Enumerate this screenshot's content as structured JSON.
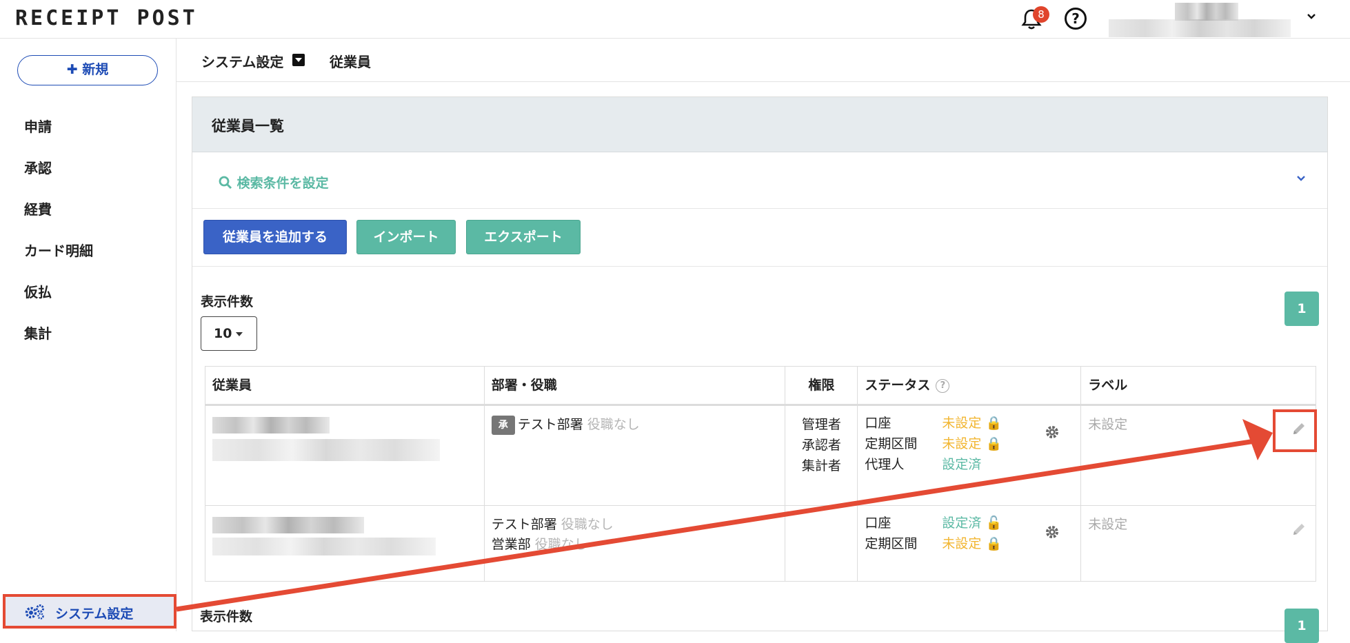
{
  "app": {
    "logo": "RECEIPT POST",
    "notification_count": "8"
  },
  "sidebar": {
    "new_button": "新規",
    "items": [
      {
        "label": "申請"
      },
      {
        "label": "承認"
      },
      {
        "label": "経費"
      },
      {
        "label": "カード明細"
      },
      {
        "label": "仮払"
      },
      {
        "label": "集計"
      }
    ],
    "system_settings": "システム設定"
  },
  "breadcrumb": {
    "section": "システム設定",
    "page": "従業員"
  },
  "card": {
    "title": "従業員一覧",
    "search_link": "検索条件を設定",
    "buttons": {
      "add": "従業員を追加する",
      "import": "インポート",
      "export": "エクスポート"
    },
    "count_label": "表示件数",
    "count_value": "10",
    "page": "1"
  },
  "table": {
    "headers": {
      "employee": "従業員",
      "dept": "部署・役職",
      "role": "権限",
      "status": "ステータス",
      "label": "ラベル"
    },
    "rows": [
      {
        "badge": "承",
        "dept1": "テスト部署",
        "title1": "役職なし",
        "roles": [
          "管理者",
          "承認者",
          "集計者"
        ],
        "status": [
          {
            "k": "口座",
            "v": "未設定",
            "state": "locked"
          },
          {
            "k": "定期区間",
            "v": "未設定",
            "state": "locked"
          },
          {
            "k": "代理人",
            "v": "設定済",
            "state": "none"
          }
        ],
        "label": "未設定"
      },
      {
        "dept1": "テスト部署",
        "title1": "役職なし",
        "dept2": "営業部",
        "title2": "役職なし",
        "status": [
          {
            "k": "口座",
            "v": "設定済",
            "state": "unlocked"
          },
          {
            "k": "定期区間",
            "v": "未設定",
            "state": "locked"
          }
        ],
        "label": "未設定"
      }
    ]
  },
  "colors": {
    "accent_blue": "#1d4bb5",
    "teal": "#5bb9a4",
    "yellow": "#f2b632",
    "annotation_red": "#e44a34"
  }
}
